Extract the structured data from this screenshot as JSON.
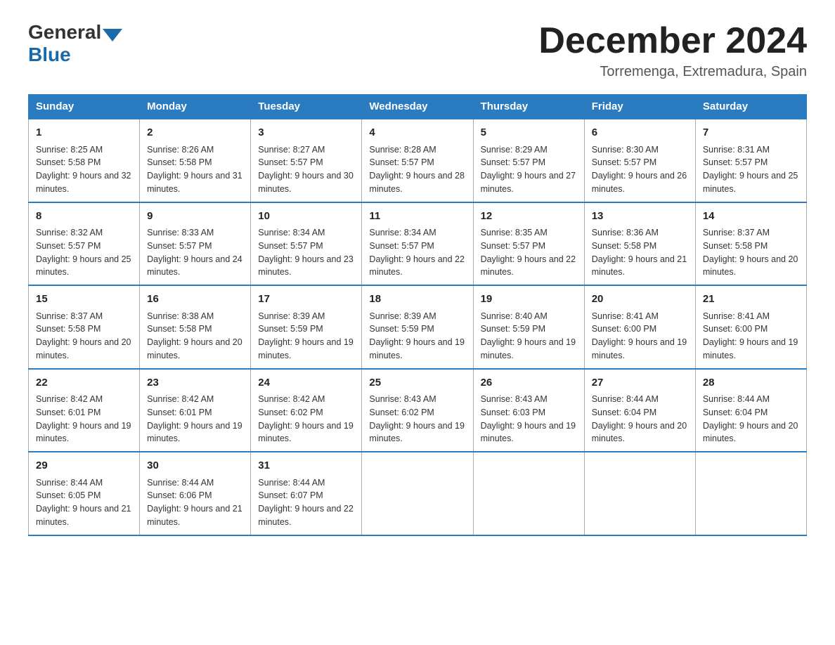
{
  "header": {
    "logo": {
      "general": "General",
      "blue": "Blue"
    },
    "title": "December 2024",
    "subtitle": "Torremenga, Extremadura, Spain"
  },
  "columns": [
    "Sunday",
    "Monday",
    "Tuesday",
    "Wednesday",
    "Thursday",
    "Friday",
    "Saturday"
  ],
  "weeks": [
    [
      {
        "day": "1",
        "sunrise": "8:25 AM",
        "sunset": "5:58 PM",
        "daylight": "9 hours and 32 minutes."
      },
      {
        "day": "2",
        "sunrise": "8:26 AM",
        "sunset": "5:58 PM",
        "daylight": "9 hours and 31 minutes."
      },
      {
        "day": "3",
        "sunrise": "8:27 AM",
        "sunset": "5:57 PM",
        "daylight": "9 hours and 30 minutes."
      },
      {
        "day": "4",
        "sunrise": "8:28 AM",
        "sunset": "5:57 PM",
        "daylight": "9 hours and 28 minutes."
      },
      {
        "day": "5",
        "sunrise": "8:29 AM",
        "sunset": "5:57 PM",
        "daylight": "9 hours and 27 minutes."
      },
      {
        "day": "6",
        "sunrise": "8:30 AM",
        "sunset": "5:57 PM",
        "daylight": "9 hours and 26 minutes."
      },
      {
        "day": "7",
        "sunrise": "8:31 AM",
        "sunset": "5:57 PM",
        "daylight": "9 hours and 25 minutes."
      }
    ],
    [
      {
        "day": "8",
        "sunrise": "8:32 AM",
        "sunset": "5:57 PM",
        "daylight": "9 hours and 25 minutes."
      },
      {
        "day": "9",
        "sunrise": "8:33 AM",
        "sunset": "5:57 PM",
        "daylight": "9 hours and 24 minutes."
      },
      {
        "day": "10",
        "sunrise": "8:34 AM",
        "sunset": "5:57 PM",
        "daylight": "9 hours and 23 minutes."
      },
      {
        "day": "11",
        "sunrise": "8:34 AM",
        "sunset": "5:57 PM",
        "daylight": "9 hours and 22 minutes."
      },
      {
        "day": "12",
        "sunrise": "8:35 AM",
        "sunset": "5:57 PM",
        "daylight": "9 hours and 22 minutes."
      },
      {
        "day": "13",
        "sunrise": "8:36 AM",
        "sunset": "5:58 PM",
        "daylight": "9 hours and 21 minutes."
      },
      {
        "day": "14",
        "sunrise": "8:37 AM",
        "sunset": "5:58 PM",
        "daylight": "9 hours and 20 minutes."
      }
    ],
    [
      {
        "day": "15",
        "sunrise": "8:37 AM",
        "sunset": "5:58 PM",
        "daylight": "9 hours and 20 minutes."
      },
      {
        "day": "16",
        "sunrise": "8:38 AM",
        "sunset": "5:58 PM",
        "daylight": "9 hours and 20 minutes."
      },
      {
        "day": "17",
        "sunrise": "8:39 AM",
        "sunset": "5:59 PM",
        "daylight": "9 hours and 19 minutes."
      },
      {
        "day": "18",
        "sunrise": "8:39 AM",
        "sunset": "5:59 PM",
        "daylight": "9 hours and 19 minutes."
      },
      {
        "day": "19",
        "sunrise": "8:40 AM",
        "sunset": "5:59 PM",
        "daylight": "9 hours and 19 minutes."
      },
      {
        "day": "20",
        "sunrise": "8:41 AM",
        "sunset": "6:00 PM",
        "daylight": "9 hours and 19 minutes."
      },
      {
        "day": "21",
        "sunrise": "8:41 AM",
        "sunset": "6:00 PM",
        "daylight": "9 hours and 19 minutes."
      }
    ],
    [
      {
        "day": "22",
        "sunrise": "8:42 AM",
        "sunset": "6:01 PM",
        "daylight": "9 hours and 19 minutes."
      },
      {
        "day": "23",
        "sunrise": "8:42 AM",
        "sunset": "6:01 PM",
        "daylight": "9 hours and 19 minutes."
      },
      {
        "day": "24",
        "sunrise": "8:42 AM",
        "sunset": "6:02 PM",
        "daylight": "9 hours and 19 minutes."
      },
      {
        "day": "25",
        "sunrise": "8:43 AM",
        "sunset": "6:02 PM",
        "daylight": "9 hours and 19 minutes."
      },
      {
        "day": "26",
        "sunrise": "8:43 AM",
        "sunset": "6:03 PM",
        "daylight": "9 hours and 19 minutes."
      },
      {
        "day": "27",
        "sunrise": "8:44 AM",
        "sunset": "6:04 PM",
        "daylight": "9 hours and 20 minutes."
      },
      {
        "day": "28",
        "sunrise": "8:44 AM",
        "sunset": "6:04 PM",
        "daylight": "9 hours and 20 minutes."
      }
    ],
    [
      {
        "day": "29",
        "sunrise": "8:44 AM",
        "sunset": "6:05 PM",
        "daylight": "9 hours and 21 minutes."
      },
      {
        "day": "30",
        "sunrise": "8:44 AM",
        "sunset": "6:06 PM",
        "daylight": "9 hours and 21 minutes."
      },
      {
        "day": "31",
        "sunrise": "8:44 AM",
        "sunset": "6:07 PM",
        "daylight": "9 hours and 22 minutes."
      },
      null,
      null,
      null,
      null
    ]
  ]
}
